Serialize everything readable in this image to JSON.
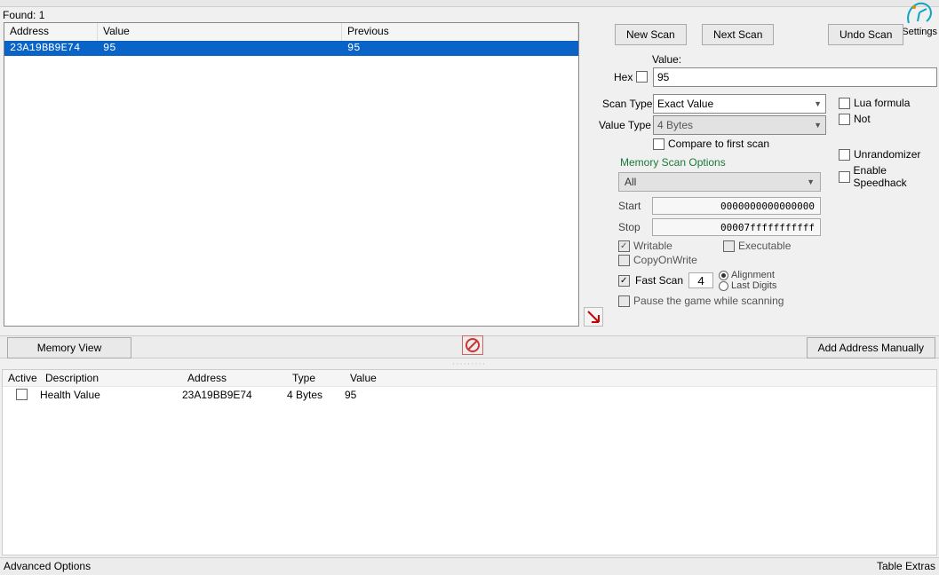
{
  "found_label": "Found: 1",
  "results": {
    "columns": {
      "address": "Address",
      "value": "Value",
      "previous": "Previous"
    },
    "row": {
      "address": "23A19BB9E74",
      "value": "95",
      "previous": "95"
    }
  },
  "buttons": {
    "new_scan": "New Scan",
    "next_scan": "Next Scan",
    "undo_scan": "Undo Scan",
    "memory_view": "Memory View",
    "add_manual": "Add Address Manually"
  },
  "settings_label": "Settings",
  "value_section": {
    "title": "Value:",
    "hex_label": "Hex",
    "value": "95"
  },
  "scan_type": {
    "label": "Scan Type",
    "value": "Exact Value"
  },
  "value_type": {
    "label": "Value Type",
    "value": "4 Bytes"
  },
  "compare_first": "Compare to first scan",
  "lua": "Lua formula",
  "not": "Not",
  "unrandom": "Unrandomizer",
  "speedhack": "Enable Speedhack",
  "mso": {
    "title": "Memory Scan Options",
    "region": "All",
    "start_label": "Start",
    "start": "0000000000000000",
    "stop_label": "Stop",
    "stop": "00007fffffffffff",
    "writable": "Writable",
    "executable": "Executable",
    "cow": "CopyOnWrite",
    "fast": "Fast Scan",
    "fast_val": "4",
    "alignment": "Alignment",
    "last_digits": "Last Digits",
    "pause": "Pause the game while scanning"
  },
  "table": {
    "columns": {
      "active": "Active",
      "description": "Description",
      "address": "Address",
      "type": "Type",
      "value": "Value"
    },
    "row": {
      "description": "Health Value",
      "address": "23A19BB9E74",
      "type": "4 Bytes",
      "value": "95"
    }
  },
  "status": {
    "left": "Advanced Options",
    "right": "Table Extras"
  }
}
